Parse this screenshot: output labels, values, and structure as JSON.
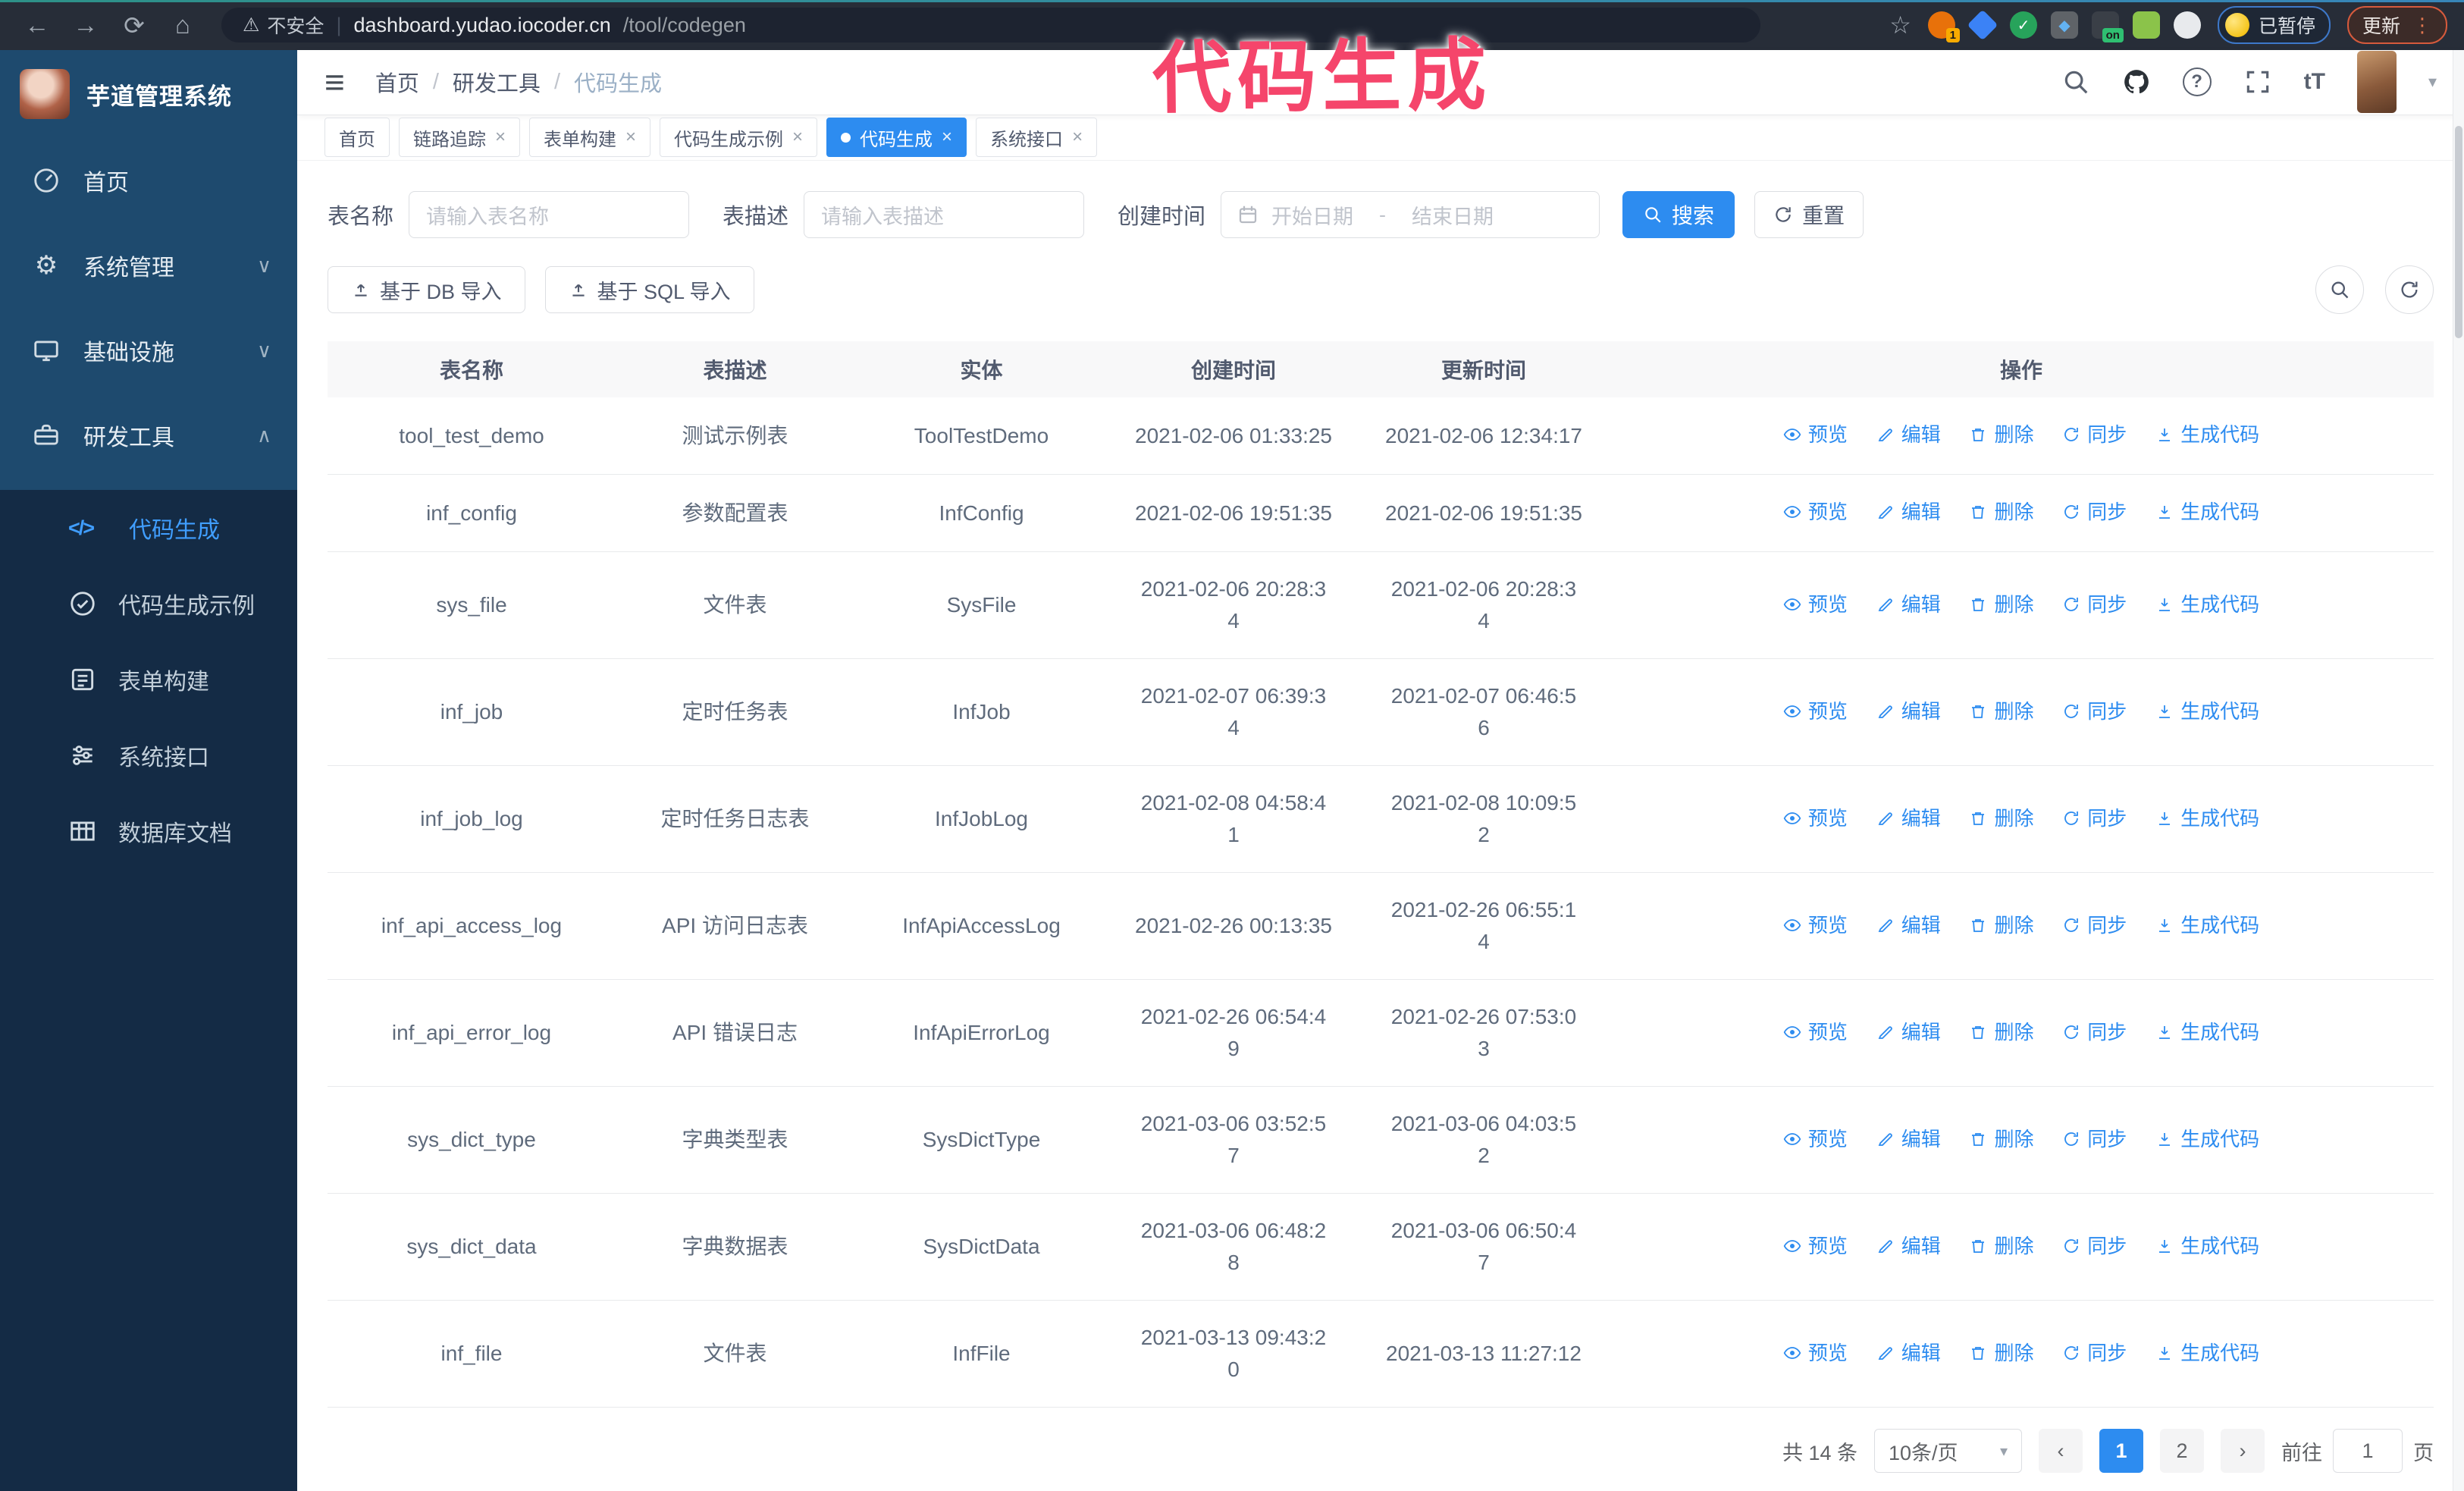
{
  "browser": {
    "security_warning": "不安全",
    "url_host": "dashboard.yudao.iocoder.cn",
    "url_path": "/tool/codegen",
    "paused_badge": "已暂停",
    "update_button": "更新",
    "extensions": [
      {
        "name": "extension-orange-circle",
        "color": "#e8710a",
        "shape": "circle",
        "badge": "1",
        "badgeColor": "#f9ab00"
      },
      {
        "name": "extension-blue-gem",
        "color": "#3b82f6",
        "shape": "diamond"
      },
      {
        "name": "extension-green-check",
        "color": "#27a35b",
        "shape": "circle",
        "glyph": "✓"
      },
      {
        "name": "extension-gray-grid",
        "color": "#5f6368",
        "shape": "square",
        "glyph": "◆",
        "glyphColor": "#63b2f2"
      },
      {
        "name": "extension-dark-on",
        "color": "#3a3f47",
        "shape": "square",
        "badge": "on",
        "badgeColor": "#2fbf71"
      },
      {
        "name": "extension-green-droid",
        "color": "#8bc34a",
        "shape": "square"
      },
      {
        "name": "extension-puzzle",
        "color": "#e8eaed",
        "shape": "circle"
      }
    ]
  },
  "annotation": {
    "text": "代码生成",
    "color": "#f5456b"
  },
  "sidebar": {
    "app_title": "芋道管理系统",
    "items": [
      {
        "label": "首页"
      },
      {
        "label": "系统管理",
        "state": "collapsed"
      },
      {
        "label": "基础设施",
        "state": "collapsed"
      },
      {
        "label": "研发工具",
        "state": "expanded"
      }
    ],
    "submenu": [
      {
        "label": "代码生成",
        "active": true
      },
      {
        "label": "代码生成示例",
        "active": false
      },
      {
        "label": "表单构建",
        "active": false
      },
      {
        "label": "系统接口",
        "active": false
      },
      {
        "label": "数据库文档",
        "active": false
      }
    ]
  },
  "header": {
    "breadcrumb": [
      "首页",
      "研发工具",
      "代码生成"
    ]
  },
  "tabs": [
    {
      "label": "首页",
      "closable": false,
      "active": false
    },
    {
      "label": "链路追踪",
      "closable": true,
      "active": false
    },
    {
      "label": "表单构建",
      "closable": true,
      "active": false
    },
    {
      "label": "代码生成示例",
      "closable": true,
      "active": false
    },
    {
      "label": "代码生成",
      "closable": true,
      "active": true
    },
    {
      "label": "系统接口",
      "closable": true,
      "active": false
    }
  ],
  "filters": {
    "table_name_label": "表名称",
    "table_name_placeholder": "请输入表名称",
    "table_desc_label": "表描述",
    "table_desc_placeholder": "请输入表描述",
    "create_time_label": "创建时间",
    "start_placeholder": "开始日期",
    "range_separator": "-",
    "end_placeholder": "结束日期",
    "search_label": "搜索",
    "reset_label": "重置"
  },
  "toolbar": {
    "import_db_label": "基于 DB 导入",
    "import_sql_label": "基于 SQL 导入"
  },
  "table": {
    "columns": [
      "表名称",
      "表描述",
      "实体",
      "创建时间",
      "更新时间",
      "操作"
    ],
    "actions": [
      "预览",
      "编辑",
      "删除",
      "同步",
      "生成代码"
    ],
    "rows": [
      {
        "name": "tool_test_demo",
        "desc": "测试示例表",
        "entity": "ToolTestDemo",
        "created": "2021-02-06 01:33:25",
        "updated": "2021-02-06 12:34:17"
      },
      {
        "name": "inf_config",
        "desc": "参数配置表",
        "entity": "InfConfig",
        "created": "2021-02-06 19:51:35",
        "updated": "2021-02-06 19:51:35"
      },
      {
        "name": "sys_file",
        "desc": "文件表",
        "entity": "SysFile",
        "created": "2021-02-06 20:28:3\n4",
        "updated": "2021-02-06 20:28:3\n4"
      },
      {
        "name": "inf_job",
        "desc": "定时任务表",
        "entity": "InfJob",
        "created": "2021-02-07 06:39:3\n4",
        "updated": "2021-02-07 06:46:5\n6"
      },
      {
        "name": "inf_job_log",
        "desc": "定时任务日志表",
        "entity": "InfJobLog",
        "created": "2021-02-08 04:58:4\n1",
        "updated": "2021-02-08 10:09:5\n2"
      },
      {
        "name": "inf_api_access_log",
        "desc": "API 访问日志表",
        "entity": "InfApiAccessLog",
        "created": "2021-02-26 00:13:35",
        "updated": "2021-02-26 06:55:1\n4"
      },
      {
        "name": "inf_api_error_log",
        "desc": "API 错误日志",
        "entity": "InfApiErrorLog",
        "created": "2021-02-26 06:54:4\n9",
        "updated": "2021-02-26 07:53:0\n3"
      },
      {
        "name": "sys_dict_type",
        "desc": "字典类型表",
        "entity": "SysDictType",
        "created": "2021-03-06 03:52:5\n7",
        "updated": "2021-03-06 04:03:5\n2"
      },
      {
        "name": "sys_dict_data",
        "desc": "字典数据表",
        "entity": "SysDictData",
        "created": "2021-03-06 06:48:2\n8",
        "updated": "2021-03-06 06:50:4\n7"
      },
      {
        "name": "inf_file",
        "desc": "文件表",
        "entity": "InfFile",
        "created": "2021-03-13 09:43:2\n0",
        "updated": "2021-03-13 11:27:12"
      }
    ]
  },
  "pagination": {
    "total_label": "共 14 条",
    "page_size": "10条/页",
    "pages": [
      "1",
      "2"
    ],
    "active_page": "1",
    "goto_label": "前往",
    "goto_value": "1",
    "page_suffix": "页"
  },
  "icons": {
    "back": "←",
    "forward": "→",
    "reload": "⟳",
    "home": "⌂",
    "warning": "⚠",
    "star": "☆",
    "hamburger": "≡",
    "caret_down": "▾",
    "chevron_down": "∨",
    "chevron_up": "∧",
    "close": "×",
    "ellipsis": "⋮",
    "help": "?",
    "font_size": "tT",
    "code": "</>",
    "slash": "/",
    "prev": "‹",
    "next": "›"
  },
  "colors": {
    "accent": "#2d8cf0",
    "annotation": "#f5456b",
    "sidebar_bg": "#142b45",
    "sidebar_panel": "#1e4a6e"
  }
}
